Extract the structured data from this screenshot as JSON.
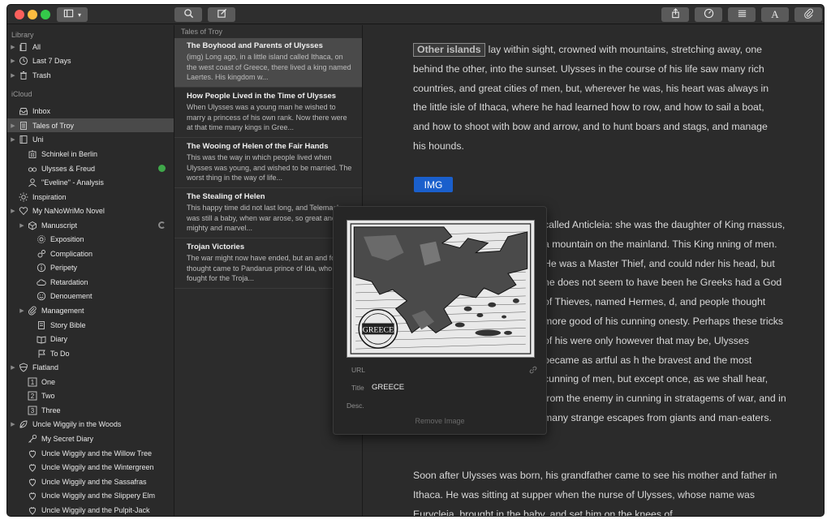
{
  "toolbar": {
    "sidebar_toggle_icon": "sidebar-icon",
    "search_icon": "search-icon",
    "compose_icon": "compose-icon",
    "share_icon": "share-icon",
    "goal_icon": "goal-icon",
    "list_icon": "list-icon",
    "format_icon": "text-format-icon",
    "attach_icon": "paperclip-icon",
    "format_label": "A"
  },
  "sidebar": {
    "library_header": "Library",
    "icloud_header": "iCloud",
    "items": [
      {
        "label": "All",
        "icon": "docs-icon"
      },
      {
        "label": "Last 7 Days",
        "icon": "clock-icon"
      },
      {
        "label": "Trash",
        "icon": "trash-icon"
      },
      {
        "label": "Inbox",
        "icon": "inbox-icon"
      },
      {
        "label": "Tales of Troy",
        "icon": "document-icon"
      },
      {
        "label": "Uni",
        "icon": "book-icon"
      },
      {
        "label": "Schinkel in Berlin",
        "icon": "building-icon"
      },
      {
        "label": "Ulysses & Freud",
        "icon": "glasses-icon"
      },
      {
        "label": "\"Eveline\" - Analysis",
        "icon": "person-icon"
      },
      {
        "label": "Inspiration",
        "icon": "sun-icon"
      },
      {
        "label": "My NaNoWriMo Novel",
        "icon": "heart-icon"
      },
      {
        "label": "Manuscript",
        "icon": "box-icon"
      },
      {
        "label": "Exposition",
        "icon": "sun-small-icon"
      },
      {
        "label": "Complication",
        "icon": "gears-icon"
      },
      {
        "label": "Peripety",
        "icon": "info-icon"
      },
      {
        "label": "Retardation",
        "icon": "cloud-icon"
      },
      {
        "label": "Denouement",
        "icon": "smiley-icon"
      },
      {
        "label": "Management",
        "icon": "paperclip-icon"
      },
      {
        "label": "Story Bible",
        "icon": "notes-icon"
      },
      {
        "label": "Diary",
        "icon": "open-book-icon"
      },
      {
        "label": "To Do",
        "icon": "flag-icon"
      },
      {
        "label": "Flatland",
        "icon": "shield-icon"
      },
      {
        "label": "One",
        "icon": "number-1-icon"
      },
      {
        "label": "Two",
        "icon": "number-2-icon"
      },
      {
        "label": "Three",
        "icon": "number-3-icon"
      },
      {
        "label": "Uncle Wiggily in the Woods",
        "icon": "leaf-icon"
      },
      {
        "label": "My Secret Diary",
        "icon": "key-icon"
      },
      {
        "label": "Uncle Wiggily and the Willow Tree",
        "icon": "strawberry-icon"
      },
      {
        "label": "Uncle Wiggily and the Wintergreen",
        "icon": "strawberry-icon"
      },
      {
        "label": "Uncle Wiggily and the Sassafras",
        "icon": "strawberry-icon"
      },
      {
        "label": "Uncle Wiggily and the Slippery Elm",
        "icon": "strawberry-icon"
      },
      {
        "label": "Uncle Wiggily and the Pulpit-Jack",
        "icon": "strawberry-icon"
      }
    ]
  },
  "doclist": {
    "header": "Tales of Troy",
    "docs": [
      {
        "title": "The Boyhood and Parents of Ulysses",
        "excerpt": "(img) Long ago, in a little island called Ithaca, on the west coast of Greece, there lived a king named Laertes. His kingdom w..."
      },
      {
        "title": "How People Lived in the Time of Ulysses",
        "excerpt": "When Ulysses was a young man he wished to marry a princess of his own rank. Now there were at that time many kings in Gree..."
      },
      {
        "title": "The Wooing of Helen of the Fair Hands",
        "excerpt": "This was the way in which people lived when Ulysses was young, and wished to be married. The worst thing in the way of life..."
      },
      {
        "title": "The Stealing of Helen",
        "excerpt": "This happy time did not last long, and Telemachus was still a baby, when war arose, so great and mighty and marvel..."
      },
      {
        "title": "Trojan Victories",
        "excerpt": "The war might now have ended, but an and foolish thought came to Pandarus prince of Ida, who fought for the Troja..."
      }
    ]
  },
  "editor": {
    "tag_label": "Other islands",
    "para1_rest": "lay within sight, crowned with mountains, stretching away, one behind the other, into the sunset. Ulysses in the course of his life saw many rich countries, and great cities of men, but, wherever he was, his heart was always in the little isle of Ithaca, where he had learned how to row, and how to sail a boat, and how to shoot with bow and arrow, and to hunt boars and stags, and manage his hounds.",
    "img_tag": "IMG",
    "para2": "called Anticleia: she was the daughter of King rnassus, a mountain on the mainland. This King nning of men. He was a Master Thief, and could nder his head, but he does not seem to have been he Greeks had a God of Thieves, named Hermes, d, and people thought more good of his cunning onesty. Perhaps these tricks of his were only however that may be, Ulysses became as artful as h the bravest and the most cunning of men, but except once, as we shall hear, from the enemy in cunning in stratagems of war, and in many strange escapes from giants and man-eaters.",
    "para3": "Soon after Ulysses was born, his grandfather came to see his mother and father in Ithaca. He was sitting at supper when the nurse of Ulysses, whose name was Eurycleia, brought in the baby, and set him on the knees of"
  },
  "popover": {
    "map_label": "GREECE",
    "url_label": "URL",
    "url_value": "",
    "title_label": "Title",
    "title_value": "GREECE",
    "desc_label": "Desc.",
    "desc_value": "",
    "remove_label": "Remove Image"
  }
}
